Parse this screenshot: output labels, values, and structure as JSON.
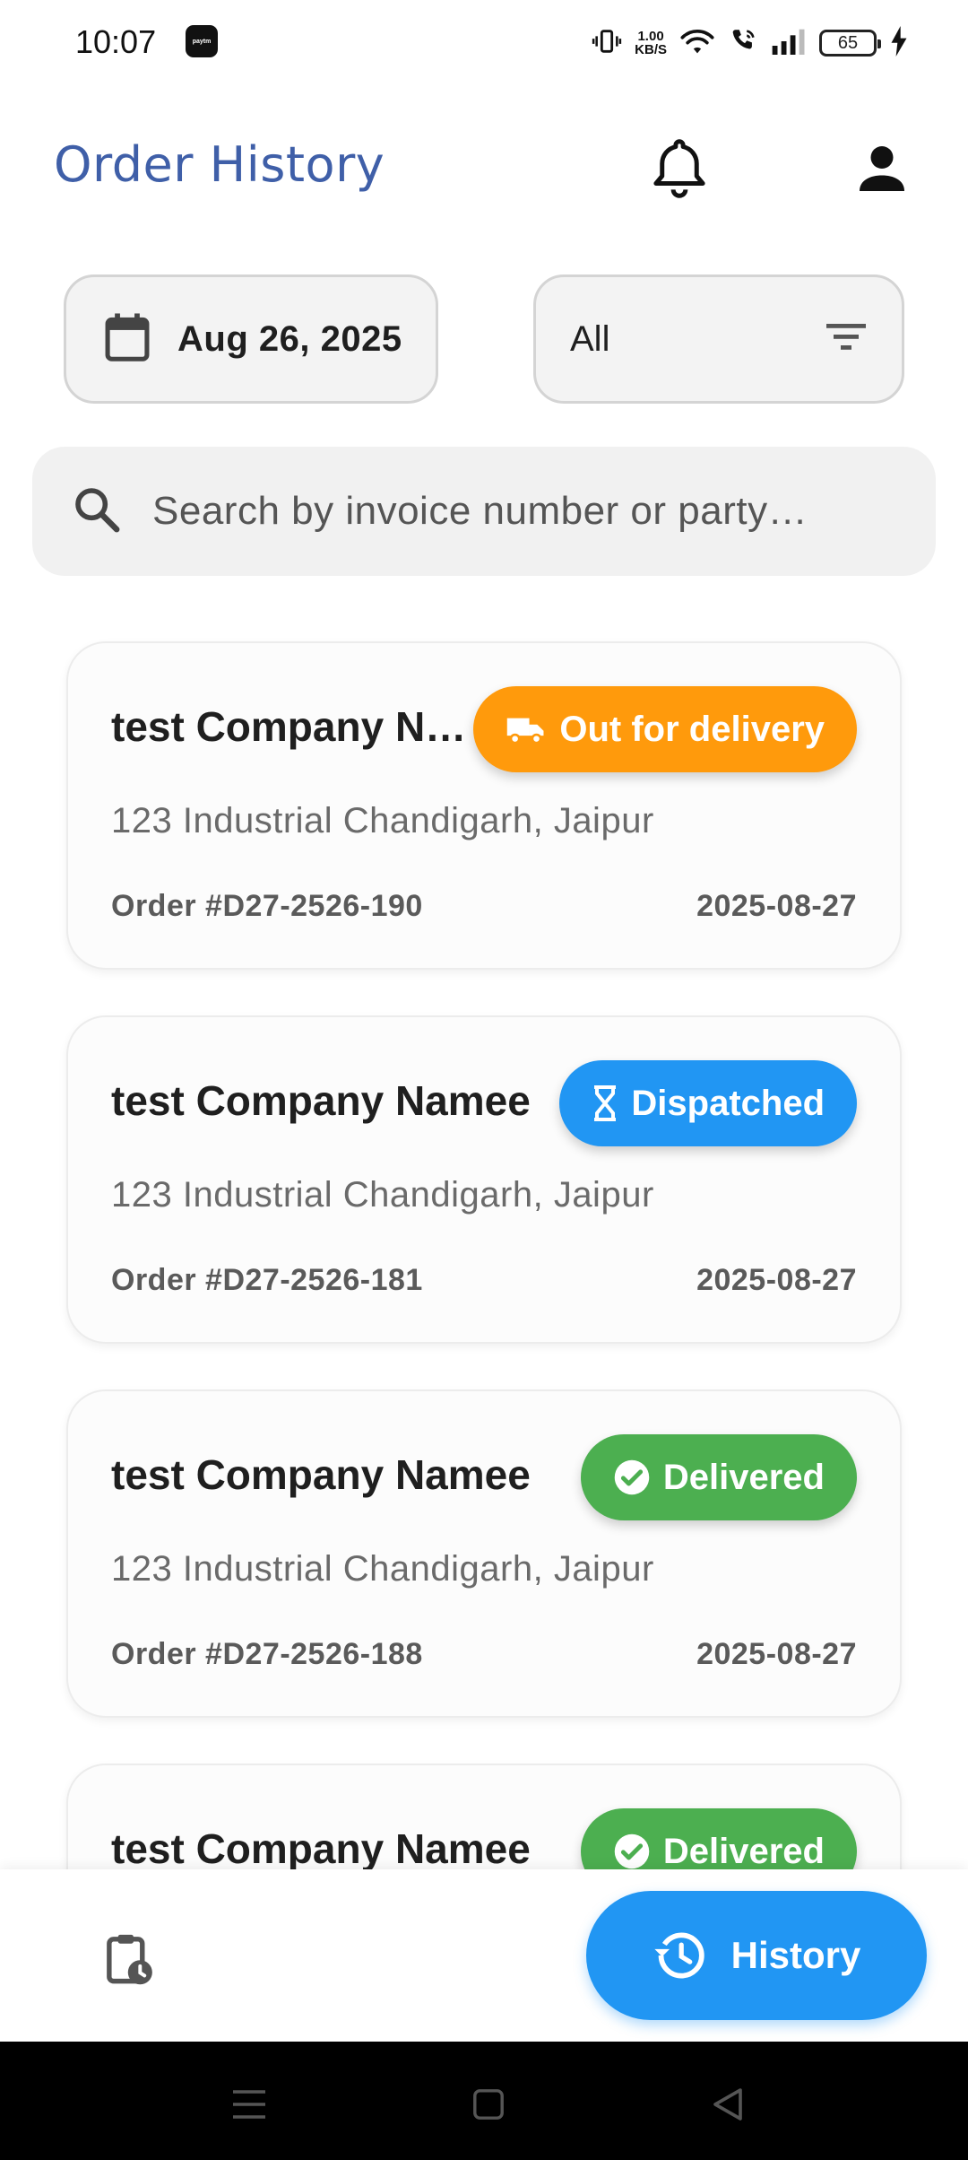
{
  "status_bar": {
    "time": "10:07",
    "app_badge": "Paytm",
    "network_speed_value": "1.00",
    "network_speed_unit": "KB/S",
    "battery": "65"
  },
  "header": {
    "title": "Order History",
    "notification_icon": "bell-icon",
    "profile_icon": "person-icon"
  },
  "filters": {
    "date_label": "Aug 26, 2025",
    "status_label": "All"
  },
  "search": {
    "placeholder": "Search by invoice number or party…"
  },
  "orders": [
    {
      "company": "test Company N…",
      "status": "Out for delivery",
      "status_icon": "truck-icon",
      "status_color": "#ff9a0c",
      "address": "123 Industrial Chandigarh, Jaipur",
      "order_no": "Order #D27-2526-190",
      "date": "2025-08-27"
    },
    {
      "company": "test Company Namee",
      "status": "Dispatched",
      "status_icon": "hourglass-icon",
      "status_color": "#2196f3",
      "address": "123 Industrial Chandigarh, Jaipur",
      "order_no": "Order #D27-2526-181",
      "date": "2025-08-27"
    },
    {
      "company": "test Company Namee",
      "status": "Delivered",
      "status_icon": "check-circle-icon",
      "status_color": "#4caf50",
      "address": "123 Industrial Chandigarh, Jaipur",
      "order_no": "Order #D27-2526-188",
      "date": "2025-08-27"
    },
    {
      "company": "test Company Namee",
      "status": "Delivered",
      "status_icon": "check-circle-icon",
      "status_color": "#4caf50"
    }
  ],
  "bottom_nav": {
    "orders_icon": "clipboard-clock-icon",
    "history_label": "History",
    "history_icon": "history-icon"
  },
  "colors": {
    "accent": "#2196f3",
    "title": "#3f5fa8"
  }
}
